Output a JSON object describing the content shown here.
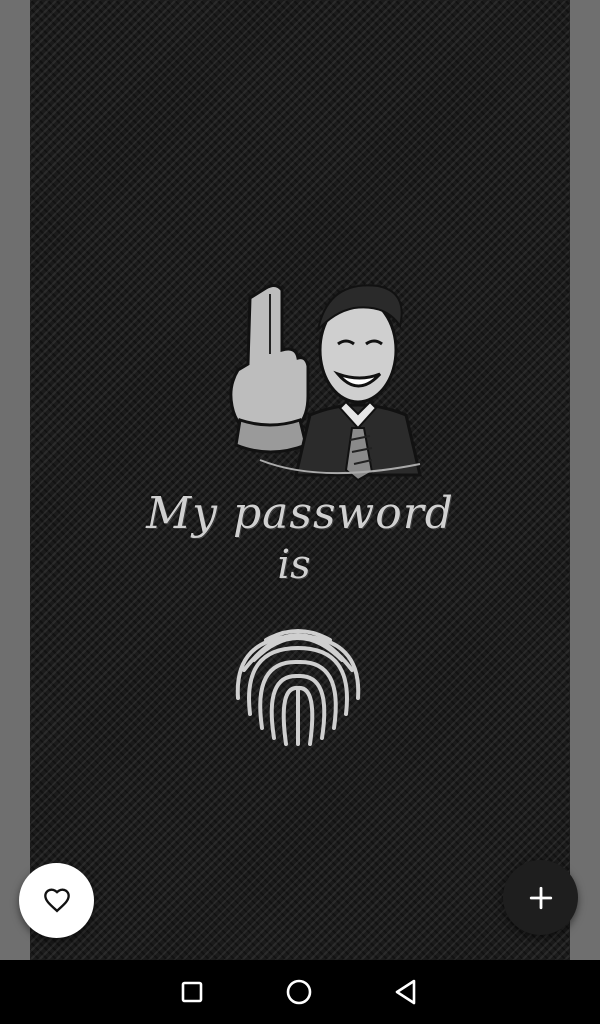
{
  "wallpaper": {
    "caption_line1": "My password",
    "caption_line2": "is"
  },
  "actions": {
    "favorite_icon": "heart-outline-icon",
    "add_icon": "plus-icon"
  },
  "navbar": {
    "recents_icon": "square-icon",
    "home_icon": "circle-icon",
    "back_icon": "triangle-back-icon"
  },
  "colors": {
    "side_margin": "#6f6f6f",
    "wallpaper_base": "#1b1b1b",
    "fab_favorite": "#ffffff",
    "fab_add": "#1e1e1e",
    "navbar": "#000000"
  }
}
